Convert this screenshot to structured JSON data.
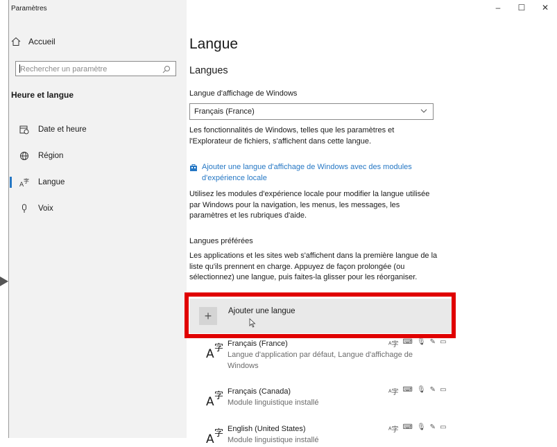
{
  "window": {
    "title": "Paramètres",
    "controls": [
      "–",
      "☐",
      "✕"
    ]
  },
  "sidebar": {
    "home_label": "Accueil",
    "search_placeholder": "Rechercher un paramètre",
    "section_heading": "Heure et langue",
    "items": [
      {
        "label": "Date et heure",
        "icon": "calendar-clock-icon",
        "selected": false
      },
      {
        "label": "Région",
        "icon": "globe-icon",
        "selected": false
      },
      {
        "label": "Langue",
        "icon": "language-icon",
        "selected": true
      },
      {
        "label": "Voix",
        "icon": "microphone-icon",
        "selected": false
      }
    ]
  },
  "main": {
    "title": "Langue",
    "subtitle": "Langues",
    "display_language_label": "Langue d'affichage de Windows",
    "display_language_value": "Français (France)",
    "display_language_desc": "Les fonctionnalités de Windows, telles que les paramètres et l'Explorateur de fichiers, s'affichent dans cette langue.",
    "add_display_link": "Ajouter une langue d'affichage de Windows avec des modules d'expérience locale",
    "local_experience_desc": "Utilisez les modules d'expérience locale pour modifier la langue utilisée par Windows pour la navigation, les menus, les messages, les paramètres et les rubriques d'aide.",
    "preferred_label": "Langues préférées",
    "preferred_desc": "Les applications et les sites web s'affichent dans la première langue de la liste qu'ils prennent en charge. Appuyez de façon prolongée (ou sélectionnez) une langue, puis faites-la glisser pour les réorganiser.",
    "add_language_label": "Ajouter une langue",
    "languages": [
      {
        "name": "Français (France)",
        "desc": "Langue d'application par défaut, Langue d'affichage de Windows"
      },
      {
        "name": "Français (Canada)",
        "desc": "Module linguistique installé"
      },
      {
        "name": "English (United States)",
        "desc": "Module linguistique installé"
      }
    ]
  },
  "colors": {
    "accent": "#2577c4",
    "highlight": "#e00000",
    "sidebar_bg": "#f2f2f2"
  }
}
